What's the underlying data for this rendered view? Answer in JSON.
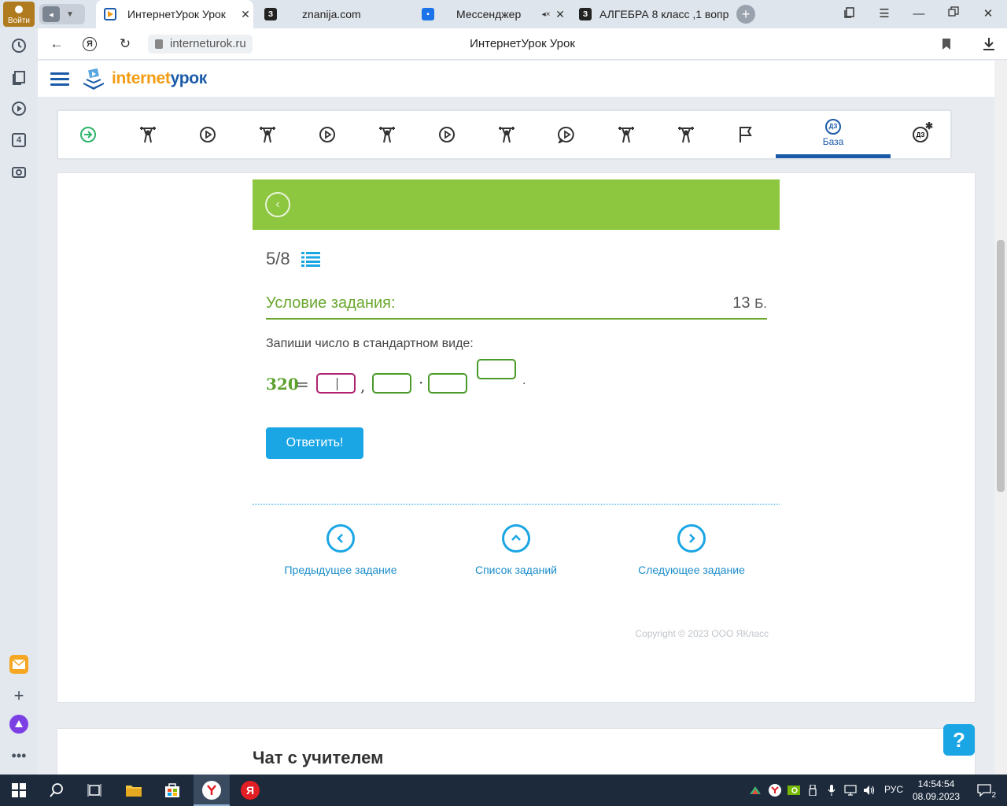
{
  "browser": {
    "login_label": "Войти",
    "tabs": [
      {
        "title": "ИнтернетУрок Урок",
        "close": "✕"
      },
      {
        "title": "znanija.com"
      },
      {
        "title": "Мессенджер",
        "close": "✕"
      },
      {
        "title": "АЛГЕБРА 8 класс ,1 вопро"
      }
    ],
    "sidebar_badge": "4",
    "url": "interneturok.ru",
    "page_title": "ИнтернетУрок Урок"
  },
  "site": {
    "logo": {
      "part1": "internet",
      "part2": "урок"
    },
    "steps": [
      {
        "icon": "arrow-right-circle-icon"
      },
      {
        "icon": "weightlifter-icon"
      },
      {
        "icon": "play-icon"
      },
      {
        "icon": "weightlifter-icon"
      },
      {
        "icon": "play-icon"
      },
      {
        "icon": "weightlifter-icon"
      },
      {
        "icon": "play-icon"
      },
      {
        "icon": "weightlifter-icon"
      },
      {
        "icon": "play-speech-icon"
      },
      {
        "icon": "weightlifter-icon"
      },
      {
        "icon": "weightlifter-icon"
      },
      {
        "icon": "flag-icon"
      },
      {
        "icon": "homework-icon",
        "badge": "ДЗ",
        "label": "База",
        "active": true
      },
      {
        "icon": "homework-star-icon",
        "badge": "ДЗ"
      }
    ],
    "task": {
      "counter": "5/8",
      "condition_title": "Условие задания:",
      "points_value": "13",
      "points_unit": "Б.",
      "instruction": "Запиши число в стандартном виде:",
      "equation": {
        "number": "320",
        "equals": "=",
        "comma": ",",
        "dot": "·",
        "period": "."
      },
      "answer_button": "Ответить!"
    },
    "nav": {
      "prev": "Предыдущее задание",
      "list": "Список заданий",
      "next": "Следующее задание"
    },
    "copyright": "Copyright © 2023 ООО ЯКласс",
    "chat_title": "Чат с учителем",
    "help": "?"
  },
  "taskbar": {
    "lang": "РУС",
    "time": "14:54:54",
    "date": "08.09.2023",
    "notifications": "2"
  },
  "colors": {
    "green": "#8dc63f",
    "green_dark": "#6aa82f",
    "blue": "#1aa6e4",
    "brand_blue": "#1b5aa8",
    "brand_orange": "#f39c12",
    "focus": "#b0216f"
  }
}
